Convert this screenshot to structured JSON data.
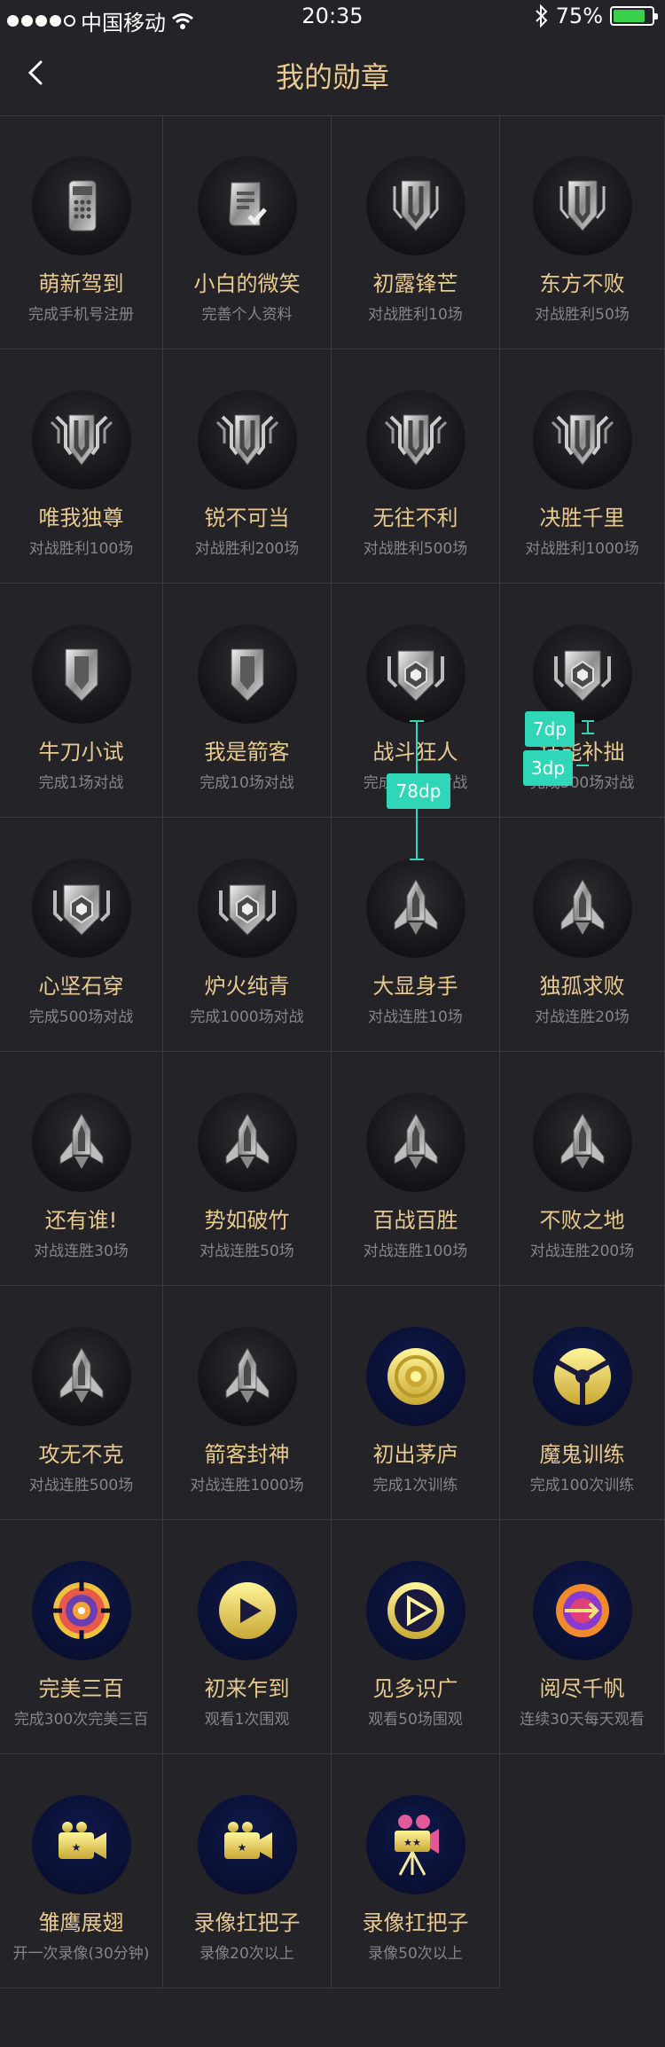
{
  "status": {
    "carrier": "中国移动",
    "time": "20:35",
    "battery": "75%",
    "signal_icon": "signal-dots-icon",
    "wifi_icon": "wifi-icon",
    "bluetooth_icon": "bluetooth-icon"
  },
  "nav": {
    "title": "我的勋章",
    "back_icon": "chevron-left-icon"
  },
  "badges": [
    {
      "name": "萌新驾到",
      "desc": "完成手机号注册",
      "icon": "phone-icon"
    },
    {
      "name": "小白的微笑",
      "desc": "完善个人资料",
      "icon": "document-check-icon"
    },
    {
      "name": "初露锋芒",
      "desc": "对战胜利10场",
      "icon": "shield-icon"
    },
    {
      "name": "东方不败",
      "desc": "对战胜利50场",
      "icon": "shield-icon"
    },
    {
      "name": "唯我独尊",
      "desc": "对战胜利100场",
      "icon": "shield-wings-icon"
    },
    {
      "name": "锐不可当",
      "desc": "对战胜利200场",
      "icon": "shield-wings-icon"
    },
    {
      "name": "无往不利",
      "desc": "对战胜利500场",
      "icon": "shield-wings-icon"
    },
    {
      "name": "决胜千里",
      "desc": "对战胜利1000场",
      "icon": "shield-wings-icon"
    },
    {
      "name": "牛刀小试",
      "desc": "完成1场对战",
      "icon": "shield-plain-icon"
    },
    {
      "name": "我是箭客",
      "desc": "完成10场对战",
      "icon": "shield-plain-icon"
    },
    {
      "name": "战斗狂人",
      "desc": "完成100场对战",
      "icon": "shield-hex-icon"
    },
    {
      "name": "技能补拙",
      "desc": "完成300场对战",
      "icon": "shield-hex-icon"
    },
    {
      "name": "心坚石穿",
      "desc": "完成500场对战",
      "icon": "shield-hex-icon"
    },
    {
      "name": "炉火纯青",
      "desc": "完成1000场对战",
      "icon": "shield-hex-icon"
    },
    {
      "name": "大显身手",
      "desc": "对战连胜10场",
      "icon": "rocket-icon"
    },
    {
      "name": "独孤求败",
      "desc": "对战连胜20场",
      "icon": "rocket-icon"
    },
    {
      "name": "还有谁!",
      "desc": "对战连胜30场",
      "icon": "rocket-icon"
    },
    {
      "name": "势如破竹",
      "desc": "对战连胜50场",
      "icon": "rocket-icon"
    },
    {
      "name": "百战百胜",
      "desc": "对战连胜100场",
      "icon": "rocket-icon"
    },
    {
      "name": "不败之地",
      "desc": "对战连胜200场",
      "icon": "rocket-icon"
    },
    {
      "name": "攻无不克",
      "desc": "对战连胜500场",
      "icon": "rocket-icon"
    },
    {
      "name": "箭客封神",
      "desc": "对战连胜1000场",
      "icon": "rocket-icon"
    },
    {
      "name": "初出茅庐",
      "desc": "完成1次训练",
      "icon": "target-icon"
    },
    {
      "name": "魔鬼训练",
      "desc": "完成100次训练",
      "icon": "wheel-icon"
    },
    {
      "name": "完美三百",
      "desc": "完成300次完美三百",
      "icon": "bullseye-icon"
    },
    {
      "name": "初来乍到",
      "desc": "观看1次围观",
      "icon": "play-icon"
    },
    {
      "name": "见多识广",
      "desc": "观看50场围观",
      "icon": "play-outline-icon"
    },
    {
      "name": "阅尽千帆",
      "desc": "连续30天每天观看",
      "icon": "arrow-circle-icon"
    },
    {
      "name": "雏鹰展翅",
      "desc": "开一次录像(30分钟)",
      "icon": "video-camera-icon"
    },
    {
      "name": "录像扛把子",
      "desc": "录像20次以上",
      "icon": "video-camera-icon"
    },
    {
      "name": "录像扛把子",
      "desc": "录像50次以上",
      "icon": "movie-camera-icon"
    }
  ],
  "annotations": {
    "a1": "78dp",
    "a2": "7dp",
    "a3": "3dp"
  }
}
